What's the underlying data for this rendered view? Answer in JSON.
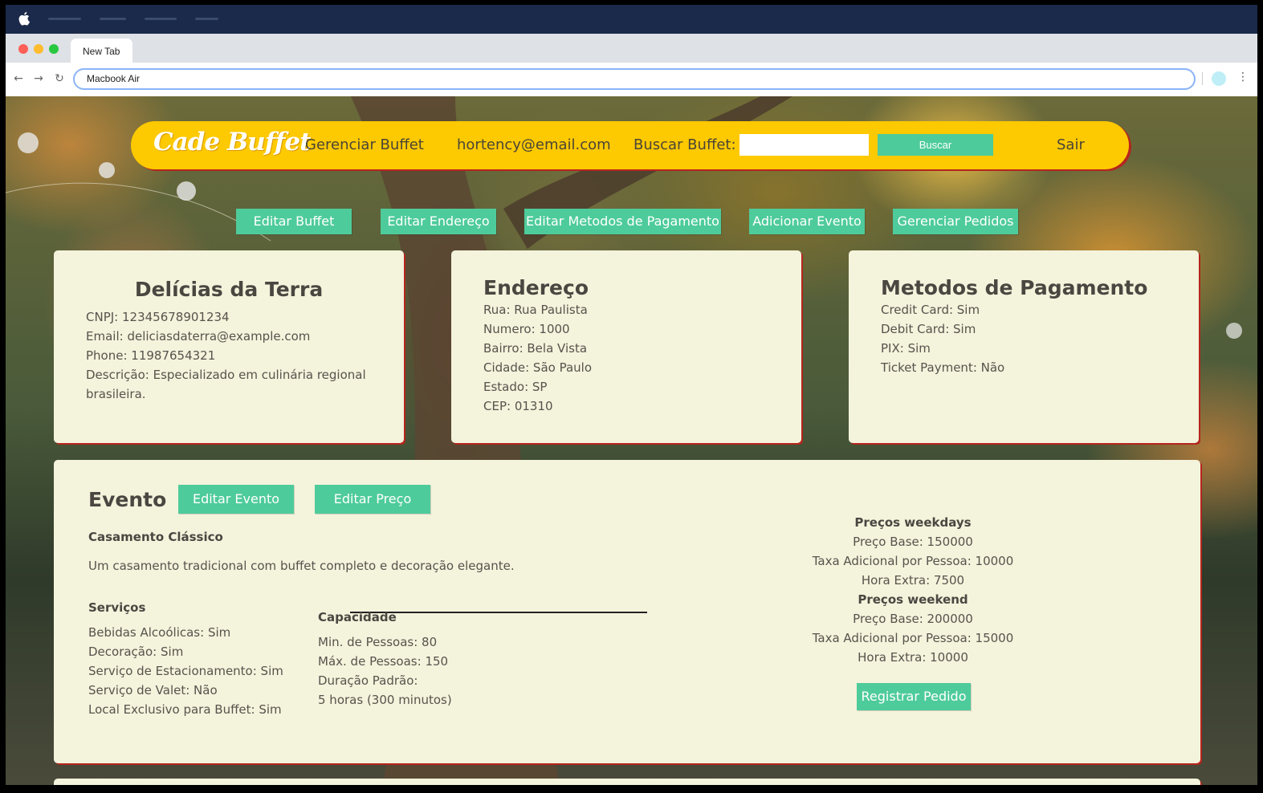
{
  "browser": {
    "tab_title": "New Tab",
    "url": "Macbook Air"
  },
  "header": {
    "logo": "Cade Buffet",
    "manage_link": "Gerenciar Buffet",
    "user_email": "hortency@email.com",
    "search_label": "Buscar Buffet:",
    "search_value": "",
    "search_button": "Buscar",
    "logout": "Sair"
  },
  "actions": [
    "Editar Buffet",
    "Editar Endereço",
    "Editar Metodos de Pagamento",
    "Adicionar Evento",
    "Gerenciar Pedidos"
  ],
  "buffet": {
    "name": "Delícias da Terra",
    "cnpj": "CNPJ: 12345678901234",
    "email": "Email: deliciasdaterra@example.com",
    "phone": "Phone: 11987654321",
    "description": "Descrição: Especializado em culinária regional brasileira."
  },
  "address": {
    "title": "Endereço",
    "street": "Rua: Rua Paulista",
    "number": "Numero: 1000",
    "district": "Bairro: Bela Vista",
    "city": "Cidade: São Paulo",
    "state": "Estado: SP",
    "zip": "CEP: 01310"
  },
  "payment": {
    "title": "Metodos de Pagamento",
    "credit": "Credit Card: Sim",
    "debit": "Debit Card: Sim",
    "pix": "PIX: Sim",
    "ticket": "Ticket Payment: Não"
  },
  "event": {
    "section_title": "Evento",
    "edit_event": "Editar Evento",
    "edit_price": "Editar Preço",
    "name": "Casamento Clássico",
    "description": "Um casamento tradicional com buffet completo e decoração elegante.",
    "services_title": "Serviços",
    "services": [
      "Bebidas Alcoólicas: Sim",
      "Decoração: Sim",
      "Serviço de Estacionamento: Sim",
      "Serviço de Valet: Não",
      "Local Exclusivo para Buffet: Sim"
    ],
    "capacity_title": "Capacidade",
    "capacity": [
      "Min. de Pessoas: 80",
      "Máx. de Pessoas: 150",
      "Duração Padrão:",
      "5 horas (300 minutos)"
    ],
    "weekdays_title": "Preços weekdays",
    "weekdays": [
      "Preço Base: 150000",
      "Taxa Adicional por Pessoa: 10000",
      "Hora Extra: 7500"
    ],
    "weekend_title": "Preços weekend",
    "weekend": [
      "Preço Base: 200000",
      "Taxa Adicional por Pessoa: 15000",
      "Hora Extra: 10000"
    ],
    "order_button": "Registrar Pedido"
  },
  "colors": {
    "header": "#fdc900",
    "accent": "#4ecb9b",
    "card": "#f4f3dc",
    "card_shadow": "#b5251d"
  }
}
